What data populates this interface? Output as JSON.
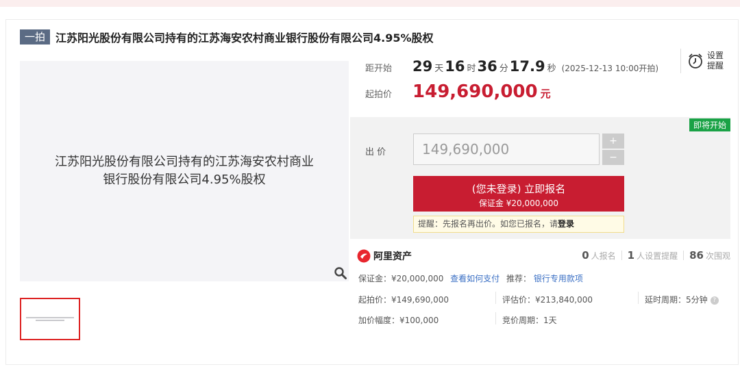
{
  "title": {
    "tag": "一拍",
    "text": "江苏阳光股份有限公司持有的江苏海安农村商业银行股份有限公司4.95%股权"
  },
  "image": {
    "line1": "江苏阳光股份有限公司持有的江苏海安农村商业",
    "line2": "银行股份有限公司4.95%股权"
  },
  "countdown": {
    "label": "距开始",
    "days": "29",
    "days_unit": "天",
    "hours": "16",
    "hours_unit": "时",
    "minutes": "36",
    "minutes_unit": "分",
    "seconds": "17.9",
    "seconds_unit": "秒",
    "start": "(2025-12-13 10:00开拍)"
  },
  "reminder": {
    "line1": "设置",
    "line2": "提醒"
  },
  "start_price": {
    "label": "起拍价",
    "value": "149,690,000",
    "unit": "元"
  },
  "bid": {
    "badge": "即将开始",
    "label": "出 价",
    "input_value": "149,690,000",
    "plus": "+",
    "minus": "−",
    "button_main": "(您未登录) 立即报名",
    "button_sub": "保证金 ¥20,000,000",
    "tip_text": "提醒：先报名再出价。如您已报名，请",
    "tip_link": "登录"
  },
  "platform": {
    "name": "阿里资产"
  },
  "stats": [
    {
      "num": "0",
      "label": "人报名"
    },
    {
      "num": "1",
      "label": "人设置提醒"
    },
    {
      "num": "86",
      "label": "次围观"
    }
  ],
  "info": {
    "deposit": "保证金：¥20,000,000",
    "how_to_pay": "查看如何支付",
    "recommend_label": "推荐：",
    "recommend_link": "银行专用款项",
    "start_price": "起拍价：¥149,690,000",
    "valuation": "评估价：¥213,840,000",
    "delay": "延时周期：5分钟",
    "increment": "加价幅度：¥100,000",
    "bid_period": "竞价周期：1天"
  },
  "colors": {
    "accent": "#c81d31",
    "badge": "#1aa246",
    "link": "#3a6fc4"
  }
}
